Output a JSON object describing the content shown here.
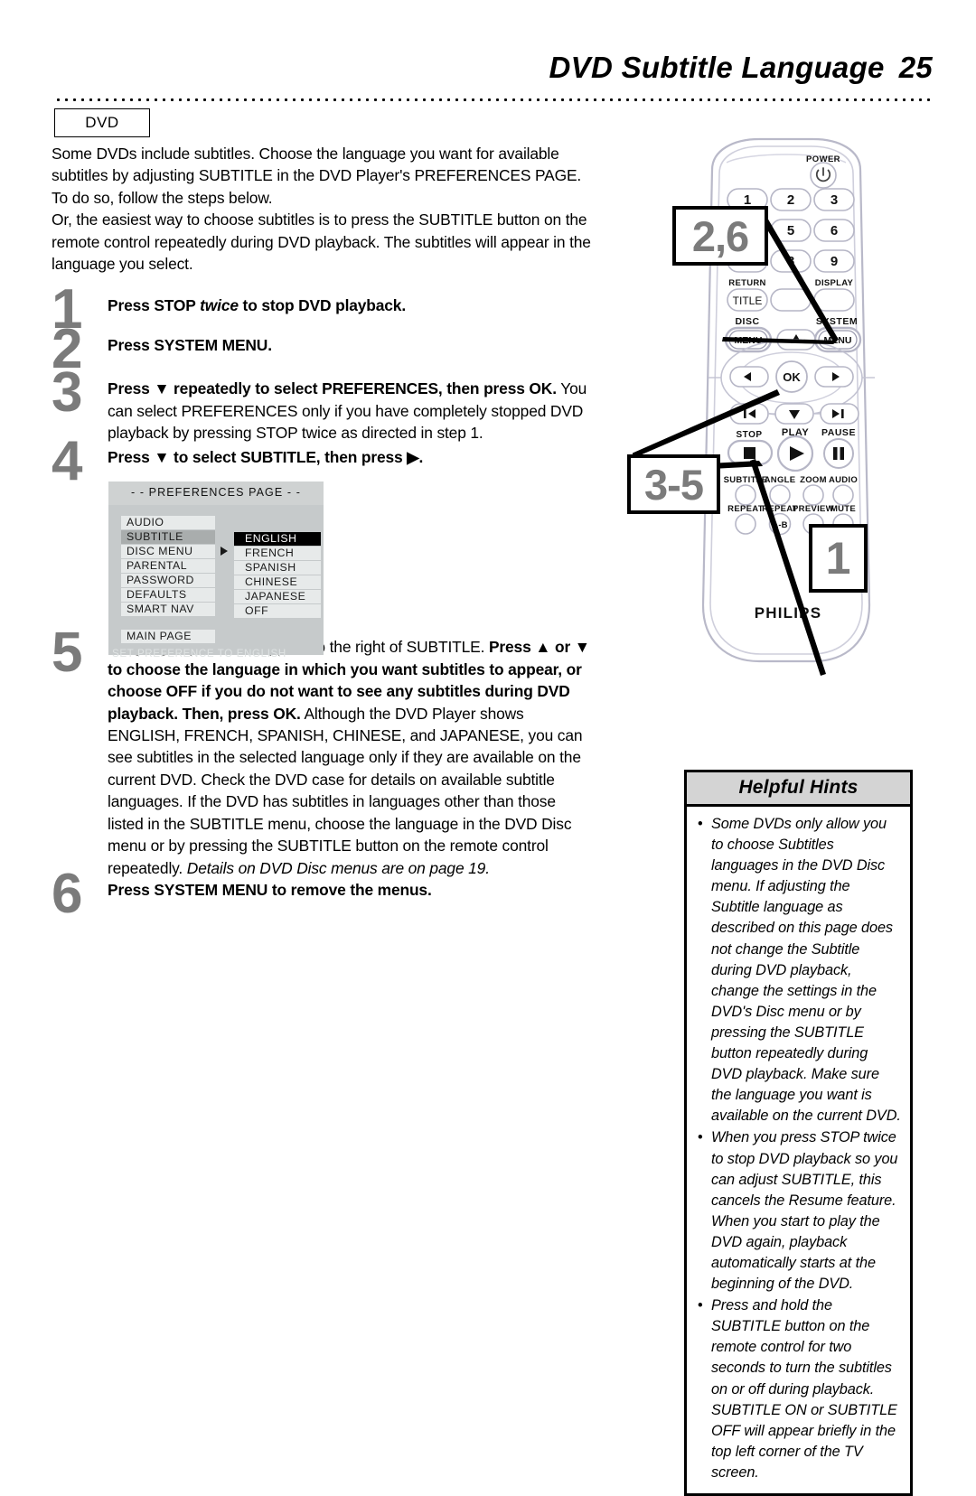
{
  "header": {
    "title": "DVD Subtitle Language",
    "page_number": "25",
    "disc_badge": "DVD"
  },
  "intro": {
    "paragraph1": "Some DVDs include subtitles. Choose the language you want for available subtitles by adjusting SUBTITLE in the DVD Player's PREFERENCES PAGE. To do so, follow the steps below.",
    "paragraph2": "Or, the easiest way to choose subtitles is to press the SUBTITLE button on the remote control repeatedly during DVD playback. The subtitles will appear in the language you select."
  },
  "steps": [
    {
      "number": "1",
      "lead": "Press STOP ",
      "lead_italic": "twice",
      "lead_tail": " to stop DVD playback.",
      "body": ""
    },
    {
      "number": "2",
      "lead": "Press SYSTEM MENU.",
      "body": ""
    },
    {
      "number": "3",
      "lead": "Press ▼ repeatedly to select PREFERENCES, then press OK.",
      "body": " You can select PREFERENCES only if you have completely stopped DVD playback by pressing STOP twice as directed in step 1."
    },
    {
      "number": "4",
      "lead": "Press ▼ to select SUBTITLE, then press ▶.",
      "body": ""
    },
    {
      "number": "5",
      "lead_plain": "Language options will appear to the right of SUBTITLE. ",
      "lead_bold": "Press ▲ or ▼ to choose the language in which you want subtitles to appear, or choose OFF if you do not want to see any subtitles during DVD playback. Then, press OK.",
      "body": "Although the DVD Player shows ENGLISH, FRENCH, SPANISH, CHINESE, and JAPANESE, you can see subtitles in the selected language only if they are available on the current DVD. Check the DVD case for details on available subtitle languages. If the DVD has subtitles in languages other than those listed in the SUBTITLE menu, choose the language in the DVD Disc menu or by pressing the SUBTITLE button on the remote control repeatedly.",
      "note": "Details on DVD Disc menus are on page 19."
    },
    {
      "number": "6",
      "lead": "Press SYSTEM MENU to remove the menus.",
      "body": ""
    }
  ],
  "osd": {
    "title": "- -  PREFERENCES PAGE  - -",
    "left_items": [
      "AUDIO",
      "SUBTITLE",
      "DISC MENU",
      "PARENTAL",
      "PASSWORD",
      "DEFAULTS",
      "SMART NAV"
    ],
    "selected_left": "SUBTITLE",
    "right_items": [
      "ENGLISH",
      "FRENCH",
      "SPANISH",
      "CHINESE",
      "JAPANESE",
      "OFF"
    ],
    "highlighted_right": "ENGLISH",
    "main_page": "MAIN PAGE",
    "status": "SET PREFERENCE TO ENGLISH"
  },
  "remote": {
    "brand": "PHILIPS",
    "power_label": "POWER",
    "keypad": [
      "1",
      "2",
      "3",
      "4",
      "5",
      "6",
      "7",
      "8",
      "9"
    ],
    "labels": {
      "return": "RETURN",
      "title": "TITLE",
      "display": "DISPLAY",
      "disc": "DISC",
      "disc_menu": "MENU",
      "system": "SYSTEM",
      "system_menu": "MENU",
      "ok": "OK",
      "stop": "STOP",
      "play": "PLAY",
      "pause": "PAUSE",
      "subtitle": "SUBTITLE",
      "angle": "ANGLE",
      "zoom": "ZOOM",
      "audio": "AUDIO",
      "repeat": "REPEAT",
      "repeat_ab_label": "REPEAT",
      "repeat_ab": "A-B",
      "preview": "PREVIEW",
      "mute": "MUTE"
    },
    "callouts": {
      "system_menu": "2,6",
      "navigation": "3-5",
      "stop": "1"
    }
  },
  "hints": {
    "title": "Helpful Hints",
    "items": [
      "Some DVDs only allow you to choose Subtitles languages in the DVD Disc menu. If adjusting the Subtitle language as described on this page does not change the Subtitle during DVD playback, change the settings in the DVD's Disc menu or by pressing the SUBTITLE button repeatedly during DVD playback. Make sure the language you want is available on the current DVD.",
      "When you press STOP twice to stop DVD playback so you can adjust SUBTITLE, this cancels the Resume feature. When you start to play the DVD again, playback automatically starts at the beginning of the DVD.",
      "Press and hold the SUBTITLE button on the remote control for two seconds to turn the subtitles on or off during playback. SUBTITLE ON or SUBTITLE OFF will appear briefly in the top left corner of the TV screen."
    ]
  },
  "colors": {
    "step_number": "#7b7b7b",
    "osd_background": "#c6cacb",
    "osd_item": "#e7eaea",
    "osd_selected": "#a9adad",
    "hints_header": "#d4d4d4"
  }
}
